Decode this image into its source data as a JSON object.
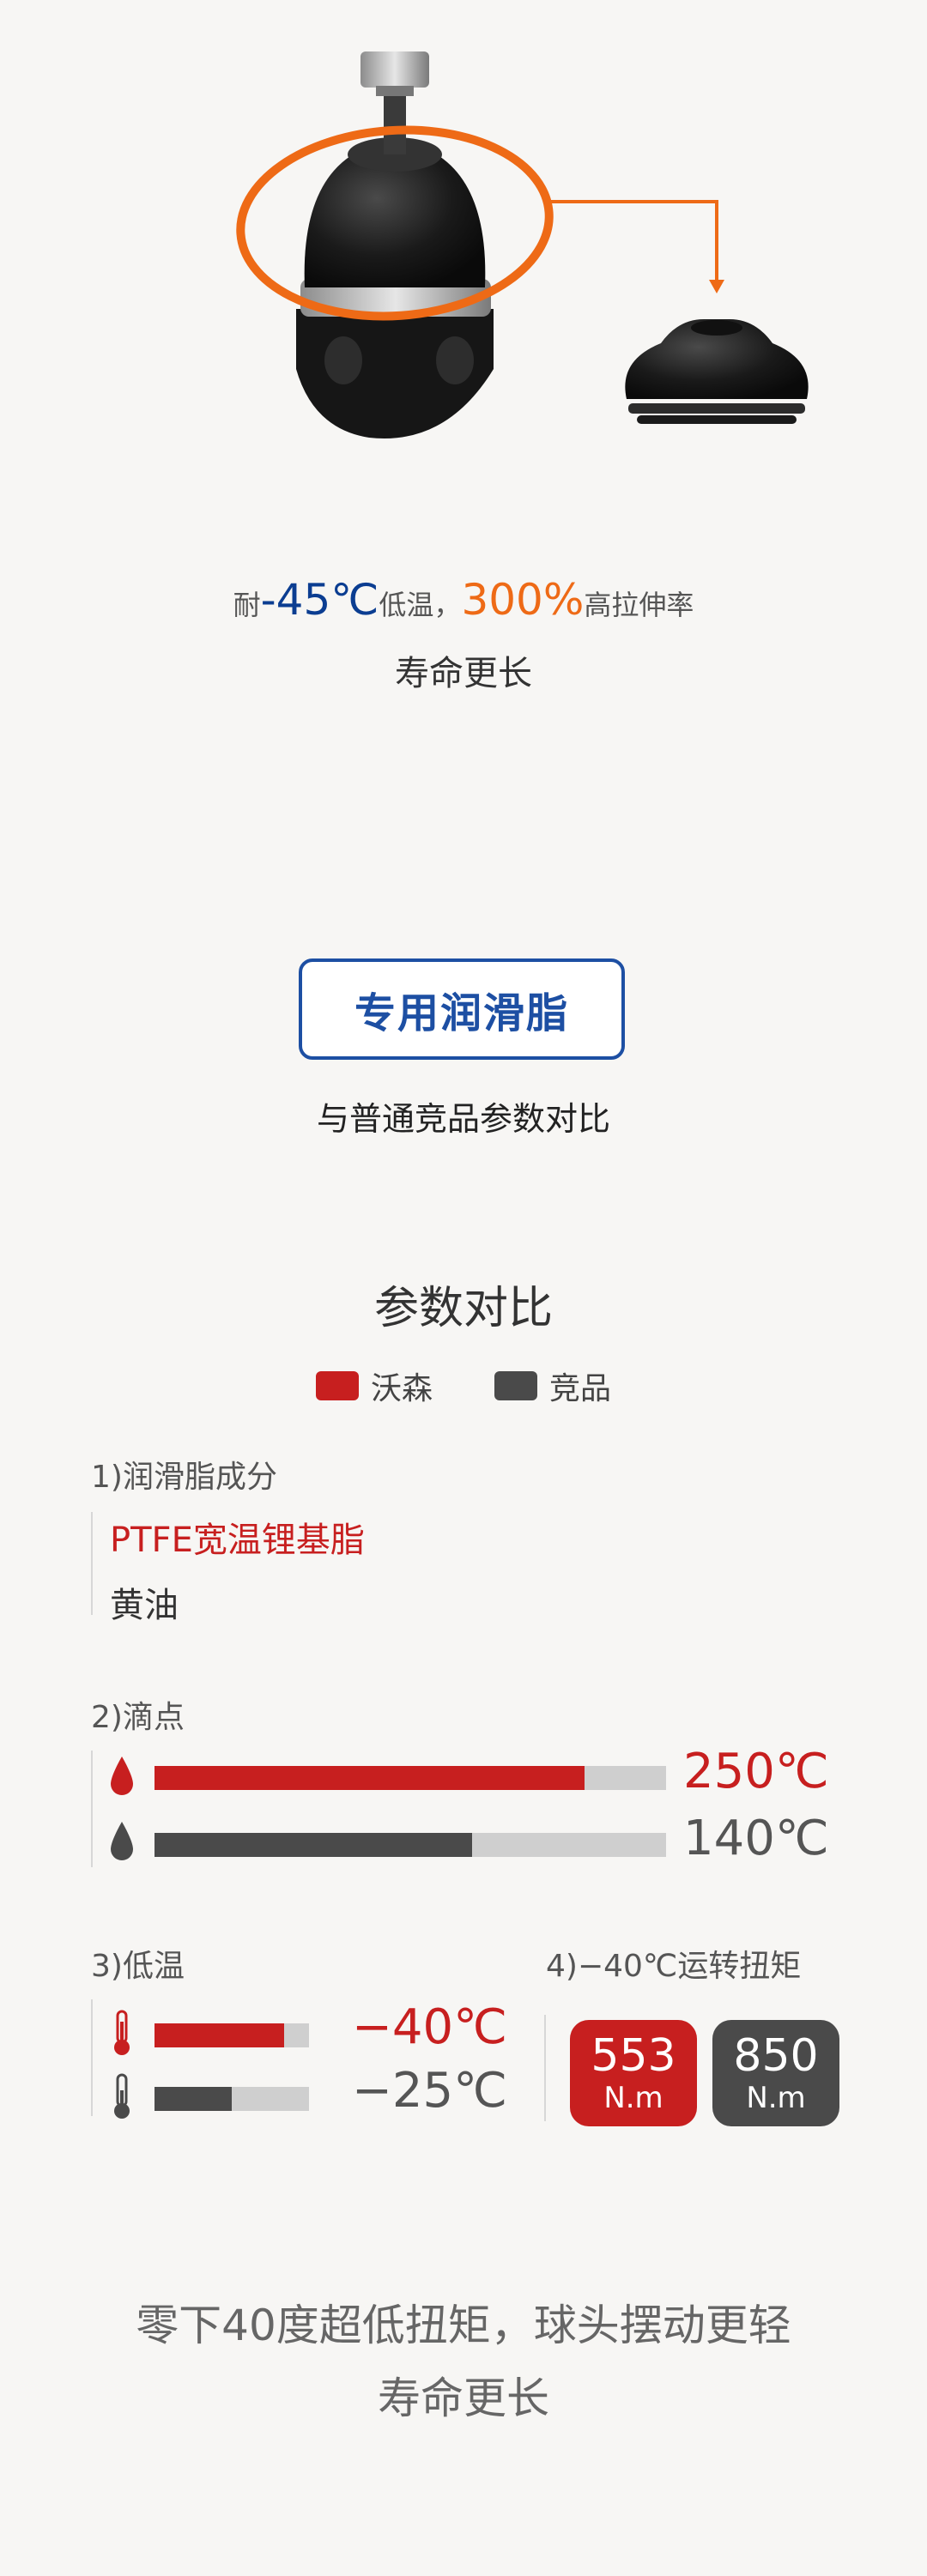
{
  "hero": {
    "feature": {
      "prefix": "耐",
      "temp": "-45℃",
      "temp_suffix": "低温，",
      "elong": "300%",
      "elong_suffix": "高拉伸率"
    },
    "life": "寿命更长"
  },
  "grease_section": {
    "badge": "专用润滑脂",
    "subtitle": "与普通竞品参数对比"
  },
  "comparison": {
    "title": "参数对比",
    "legend": [
      {
        "label": "沃森",
        "color": "#c71f1f"
      },
      {
        "label": "竞品",
        "color": "#4a4a4a"
      }
    ],
    "composition": {
      "title": "1)润滑脂成分",
      "ours": "PTFE宽温锂基脂",
      "theirs": "黄油"
    },
    "drop_point": {
      "title": "2)滴点",
      "ours_value": "250℃",
      "ours_fill": 0.84,
      "theirs_value": "140℃",
      "theirs_fill": 0.62,
      "icon_ours": "drop-icon",
      "icon_theirs": "drop-icon"
    },
    "low_temp": {
      "title": "3)低温",
      "ours_value": "−40℃",
      "ours_fill": 0.84,
      "theirs_value": "−25℃",
      "theirs_fill": 0.5,
      "icon": "thermometer-icon"
    },
    "torque": {
      "title": "4)−40℃运转扭矩",
      "ours_value": "553",
      "ours_unit": "N.m",
      "theirs_value": "850",
      "theirs_unit": "N.m"
    }
  },
  "footer": {
    "line1": "零下40度超低扭矩，球头摆动更轻",
    "line2": "寿命更长"
  },
  "colors": {
    "ours": "#c71f1f",
    "theirs": "#4a4a4a",
    "blue": "#1d4fa3",
    "orange": "#ee6a16"
  }
}
